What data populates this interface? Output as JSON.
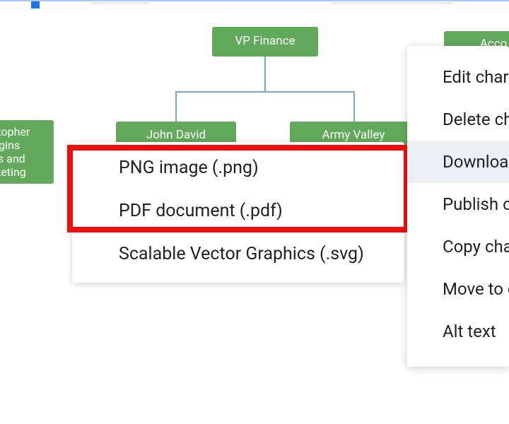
{
  "chart": {
    "nodes": {
      "root": "VP Finance",
      "left_sibling": "Christopher Higgins\nSales and Marketing",
      "child_left": "John David",
      "child_right": "Army Valley",
      "right_top": "Acco"
    }
  },
  "context_menu": {
    "items": [
      {
        "label": "Edit chart",
        "hover": false
      },
      {
        "label": "Delete cha",
        "hover": false
      },
      {
        "label": "Download",
        "hover": true
      },
      {
        "label": "Publish ch",
        "hover": false
      },
      {
        "label": "Copy char",
        "hover": false
      },
      {
        "label": "Move to ov",
        "hover": false
      },
      {
        "label": "Alt text",
        "hover": false
      }
    ]
  },
  "download_submenu": {
    "items": [
      "PNG image (.png)",
      "PDF document (.pdf)",
      "Scalable Vector Graphics (.svg)"
    ]
  }
}
